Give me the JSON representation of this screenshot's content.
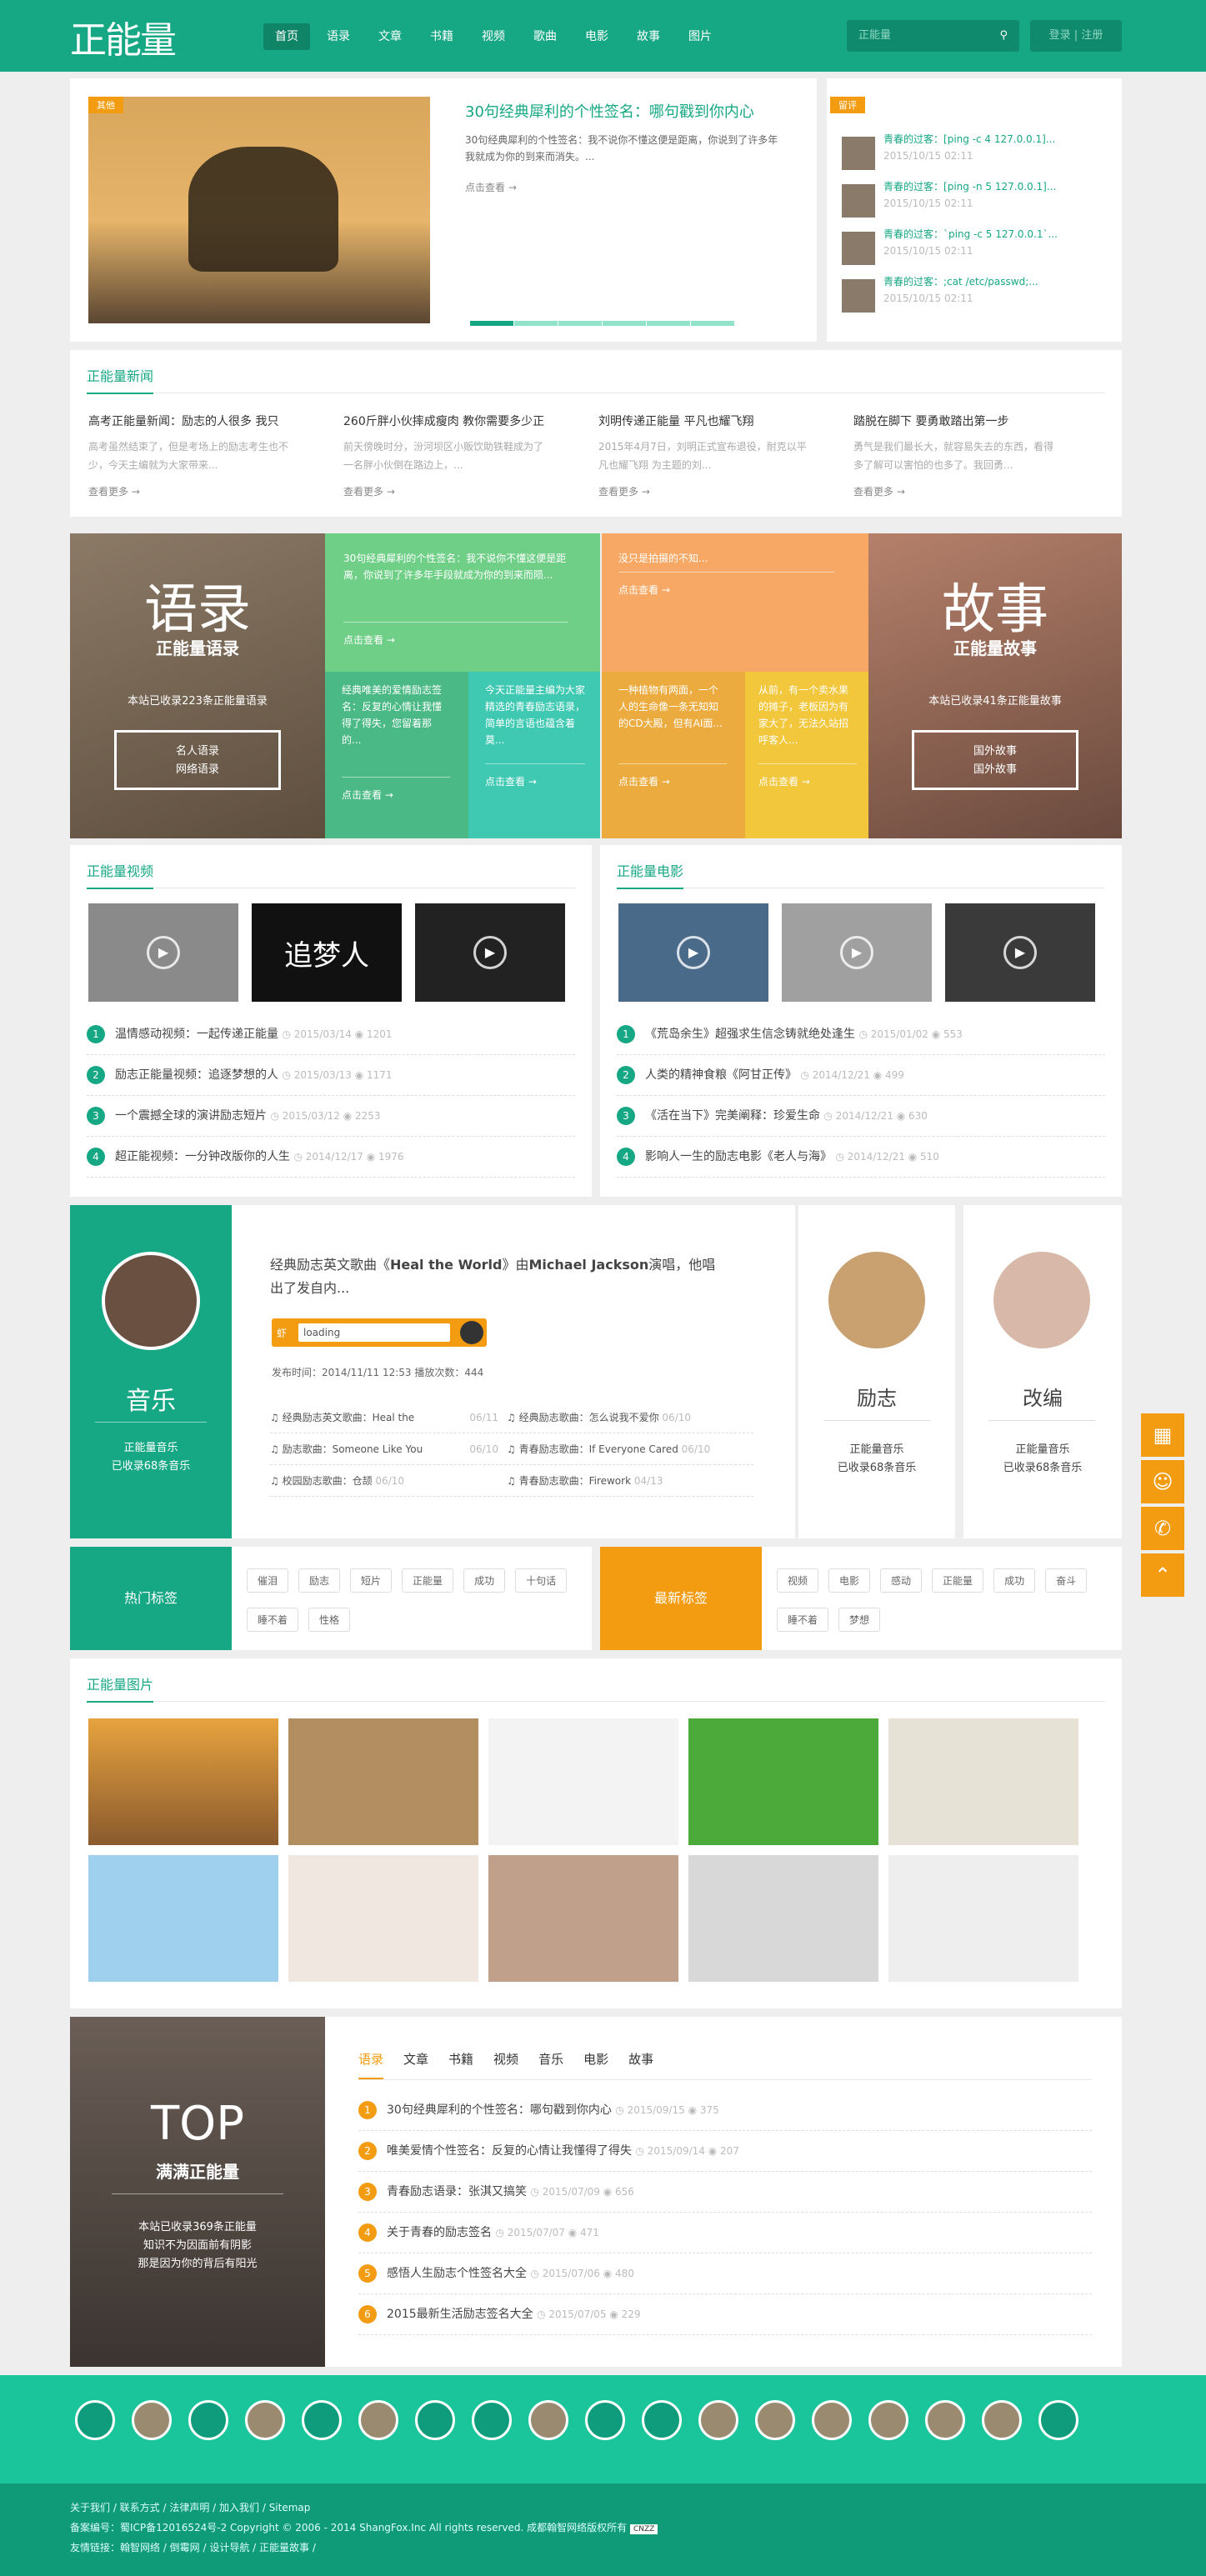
{
  "header": {
    "logo": "正能量",
    "nav": [
      "首页",
      "语录",
      "文章",
      "书籍",
      "视频",
      "歌曲",
      "电影",
      "故事",
      "图片"
    ],
    "search_placeholder": "正能量",
    "search_icon": "search-icon",
    "login": "登录",
    "register": "注册",
    "sep": "|"
  },
  "hero": {
    "tag": "其他",
    "title": "30句经典犀利的个性签名：哪句戳到你内心",
    "desc": "30句经典犀利的个性签名：我不说你不懂这便是距离，你说到了许多年我就成为你的到来而消失。...",
    "more": "点击查看 →"
  },
  "comments": {
    "tag": "留评",
    "items": [
      {
        "user": "青春的过客：",
        "text": "[ping -c 4 127.0.0.1]...",
        "time": "2015/10/15 02:11"
      },
      {
        "user": "青春的过客：",
        "text": "[ping -n 5 127.0.0.1]...",
        "time": "2015/10/15 02:11"
      },
      {
        "user": "青春的过客：",
        "text": "`ping -c 5 127.0.0.1`...",
        "time": "2015/10/15 02:11"
      },
      {
        "user": "青春的过客：",
        "text": ";cat /etc/passwd;...",
        "time": "2015/10/15 02:11"
      }
    ]
  },
  "news": {
    "title": "正能量新闻",
    "items": [
      {
        "title": "高考正能量新闻：励志的人很多 我只",
        "desc": "高考虽然结束了，但是考场上的励志考生也不少，今天主编就为大家带来...",
        "more": "查看更多 →"
      },
      {
        "title": "260斤胖小伙摔成瘦肉 教你需要多少正",
        "desc": "前天傍晚时分，汾河坝区小贩饮助铁鞋成为了一名胖小伙倒在路边上，...",
        "more": "查看更多 →"
      },
      {
        "title": "刘明传递正能量 平凡也耀飞翔",
        "desc": "2015年4月7日，刘明正式宣布退役，耐克以平凡也耀飞翔 为主题的刘...",
        "more": "查看更多 →"
      },
      {
        "title": "踏脱在脚下 要勇敢踏出第一步",
        "desc": "勇气是我们最长大，就容易失去的东西，看得多了解可以害怕的也多了。我回勇...",
        "more": "查看更多 →"
      }
    ]
  },
  "tiles": {
    "quotes": {
      "big": "语录",
      "sub": "正能量语录",
      "info": "本站已收录223条正能量语录",
      "btn1": "名人语录",
      "btn2": "网络语录"
    },
    "story": {
      "big": "故事",
      "sub": "正能量故事",
      "info": "本站已收录41条正能量故事",
      "btn1": "国外故事",
      "btn2": "国外故事"
    },
    "t1": {
      "text": "30句经典犀利的个性签名：我不说你不懂这便是距离，你说到了许多年手段就成为你的到来而陨...",
      "more": "点击查看 →"
    },
    "t2": {
      "text": "经典唯美的爱情励志签名：反复的心情让我懂得了得失，您留着那的...",
      "more": "点击查看 →"
    },
    "t3": {
      "text": "今天正能量主编为大家精选的青春励志语录，简单的言语也蕴含着莫...",
      "more": "点击查看 →"
    },
    "t4": {
      "text": "没只是拍摄的不知...",
      "more": "点击查看 →"
    },
    "t5": {
      "text": "一种植物有两面，一个人的生命像一条无知知的CD大殿，但有AI面...",
      "more": "点击查看 →"
    },
    "t6": {
      "text": "从前，有一个卖水果的摊子，老板因为有家大了，无法久站招呼客人...",
      "more": "点击查看 →"
    }
  },
  "videos": {
    "title": "正能量视频",
    "items": [
      {
        "title": "温情感动视频：一起传递正能量",
        "date": "2015/03/14",
        "views": "1201"
      },
      {
        "title": "励志正能量视频：追逐梦想的人",
        "date": "2015/03/13",
        "views": "1171"
      },
      {
        "title": "一个震撼全球的演讲励志短片",
        "date": "2015/03/12",
        "views": "2253"
      },
      {
        "title": "超正能视频：一分钟改版你的人生",
        "date": "2014/12/17",
        "views": "1976"
      }
    ]
  },
  "movies": {
    "title": "正能量电影",
    "items": [
      {
        "title": "《荒岛余生》超强求生信念铸就绝处逢生",
        "date": "2015/01/02",
        "views": "553"
      },
      {
        "title": "人类的精神食粮《阿甘正传》",
        "date": "2014/12/21",
        "views": "499"
      },
      {
        "title": "《活在当下》完美阐释：珍爱生命",
        "date": "2014/12/21",
        "views": "630"
      },
      {
        "title": "影响人一生的励志电影《老人与海》",
        "date": "2014/12/21",
        "views": "510"
      }
    ]
  },
  "music": {
    "label": "音乐",
    "sub": "正能量音乐",
    "count": "已收录68条音乐",
    "song_title_pre": "经典励志英文歌曲《",
    "song": "Heal the World",
    "song_mid": "》由",
    "artist": "Michael Jackson",
    "song_post": "演唱，他唱出了发自内...",
    "player": "loading",
    "player_icon": "虾",
    "meta": "发布时间：2014/11/11 12:53  播放次数：444",
    "list": [
      {
        "t": "经典励志英文歌曲：Heal the",
        "d": "06/11"
      },
      {
        "t": "经典励志歌曲：怎么说我不爱你",
        "d": "06/10"
      },
      {
        "t": "励志歌曲：Someone Like You",
        "d": "06/10"
      },
      {
        "t": "青春励志歌曲：If Everyone Cared",
        "d": "06/10"
      },
      {
        "t": "校园励志歌曲：仓颉",
        "d": "06/10"
      },
      {
        "t": "青春励志歌曲：Firework",
        "d": "04/13"
      }
    ],
    "cards": [
      {
        "name": "励志",
        "sub": "正能量音乐",
        "count": "已收录68条音乐"
      },
      {
        "name": "改编",
        "sub": "正能量音乐",
        "count": "已收录68条音乐"
      }
    ]
  },
  "tags": {
    "hot_label": "热门标签",
    "hot": [
      "催泪",
      "励志",
      "短片",
      "正能量",
      "成功",
      "十句话",
      "睡不着",
      "性格"
    ],
    "new_label": "最新标签",
    "new": [
      "视频",
      "电影",
      "感动",
      "正能量",
      "成功",
      "奋斗",
      "睡不着",
      "梦想"
    ]
  },
  "photos": {
    "title": "正能量图片"
  },
  "top": {
    "big": "TOP",
    "sub": "满满正能量",
    "info1": "本站已收录369条正能量",
    "info2": "知识不为因面前有阴影",
    "info3": "那是因为你的背后有阳光",
    "tabs": [
      "语录",
      "文章",
      "书籍",
      "视频",
      "音乐",
      "电影",
      "故事"
    ],
    "items": [
      {
        "t": "30句经典犀利的个性签名：哪句戳到你内心",
        "d": "2015/09/15",
        "v": "375"
      },
      {
        "t": "唯美爱情个性签名：反复的心情让我懂得了得失",
        "d": "2015/09/14",
        "v": "207"
      },
      {
        "t": "青春励志语录：张淇又搞笑",
        "d": "2015/07/09",
        "v": "656"
      },
      {
        "t": "关于青春的励志签名",
        "d": "2015/07/07",
        "v": "471"
      },
      {
        "t": "感悟人生励志个性签名大全",
        "d": "2015/07/06",
        "v": "480"
      },
      {
        "t": "2015最新生活励志签名大全",
        "d": "2015/07/05",
        "v": "229"
      }
    ]
  },
  "footer": {
    "links": "关于我们 / 联系方式 / 法律声明 / 加入我们 / Sitemap",
    "icp": "备案编号：蜀ICP备12016524号-2 Copyright © 2006 - 2014 ShangFox.Inc All rights reserved. 成都翰智网络版权所有",
    "friends": "友情链接：翰智网络 / 倒霉网 / 设计导航 / 正能量故事 /",
    "badge": "CNZZ"
  }
}
